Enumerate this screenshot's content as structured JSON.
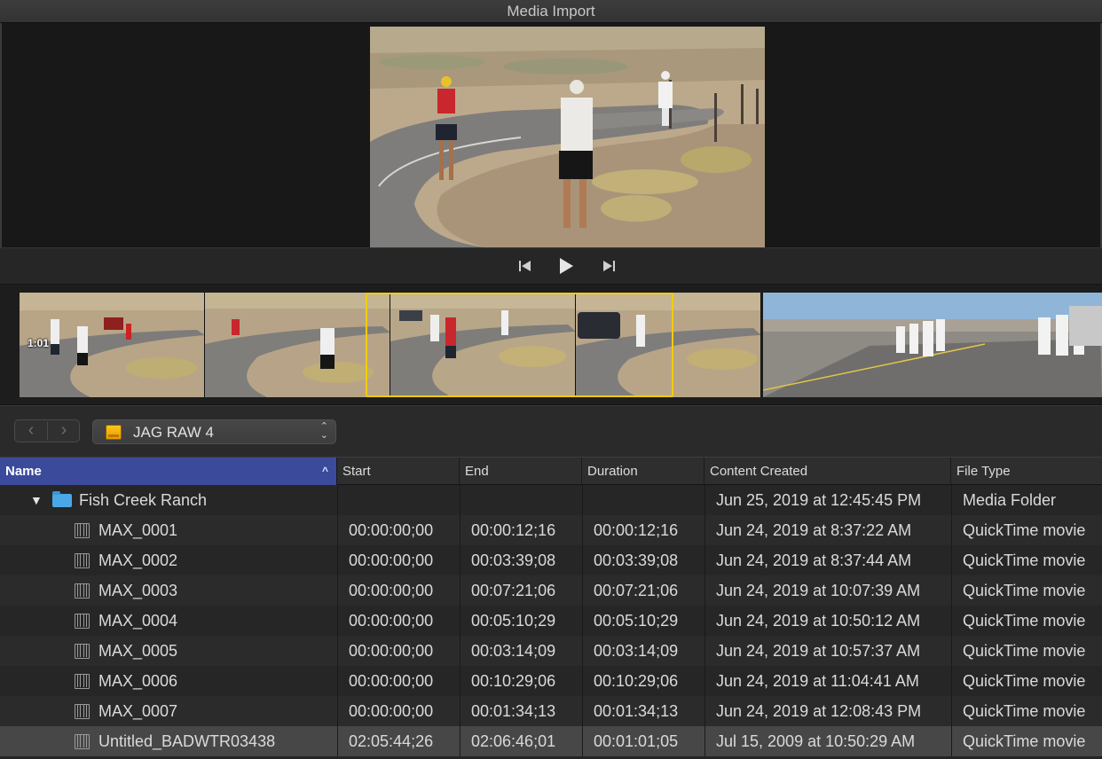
{
  "window": {
    "title": "Media Import"
  },
  "filmstrip": {
    "clip_duration_label": "1:01"
  },
  "toolbar": {
    "device_name": "JAG RAW 4"
  },
  "table": {
    "columns": [
      "Name",
      "Start",
      "End",
      "Duration",
      "Content Created",
      "File Type"
    ],
    "sort_column": "Name",
    "folder": {
      "name": "Fish Creek Ranch",
      "start": "",
      "end": "",
      "duration": "",
      "created": "Jun 25, 2019 at 12:45:45 PM",
      "type": "Media Folder"
    },
    "rows": [
      {
        "name": "MAX_0001",
        "start": "00:00:00;00",
        "end": "00:00:12;16",
        "duration": "00:00:12;16",
        "created": "Jun 24, 2019 at 8:37:22 AM",
        "type": "QuickTime movie"
      },
      {
        "name": "MAX_0002",
        "start": "00:00:00;00",
        "end": "00:03:39;08",
        "duration": "00:03:39;08",
        "created": "Jun 24, 2019 at 8:37:44 AM",
        "type": "QuickTime movie"
      },
      {
        "name": "MAX_0003",
        "start": "00:00:00;00",
        "end": "00:07:21;06",
        "duration": "00:07:21;06",
        "created": "Jun 24, 2019 at 10:07:39 AM",
        "type": "QuickTime movie"
      },
      {
        "name": "MAX_0004",
        "start": "00:00:00;00",
        "end": "00:05:10;29",
        "duration": "00:05:10;29",
        "created": "Jun 24, 2019 at 10:50:12 AM",
        "type": "QuickTime movie"
      },
      {
        "name": "MAX_0005",
        "start": "00:00:00;00",
        "end": "00:03:14;09",
        "duration": "00:03:14;09",
        "created": "Jun 24, 2019 at 10:57:37 AM",
        "type": "QuickTime movie"
      },
      {
        "name": "MAX_0006",
        "start": "00:00:00;00",
        "end": "00:10:29;06",
        "duration": "00:10:29;06",
        "created": "Jun 24, 2019 at 11:04:41 AM",
        "type": "QuickTime movie"
      },
      {
        "name": "MAX_0007",
        "start": "00:00:00;00",
        "end": "00:01:34;13",
        "duration": "00:01:34;13",
        "created": "Jun 24, 2019 at 12:08:43 PM",
        "type": "QuickTime movie"
      },
      {
        "name": "Untitled_BADWTR03438",
        "start": "02:05:44;26",
        "end": "02:06:46;01",
        "duration": "00:01:01;05",
        "created": "Jul 15, 2009 at 10:50:29 AM",
        "type": "QuickTime movie",
        "selected": true
      }
    ]
  },
  "colors": {
    "selection": "#f2cc0c",
    "header_active": "#3b4a9a",
    "folder": "#4aa8e8",
    "device": "#ffc41c"
  },
  "icons": [
    "previous-frame-icon",
    "play-icon",
    "next-frame-icon",
    "back-icon",
    "forward-icon",
    "drive-icon",
    "folder-icon",
    "film-icon",
    "disclosure-triangle-icon",
    "sort-ascending-icon"
  ]
}
